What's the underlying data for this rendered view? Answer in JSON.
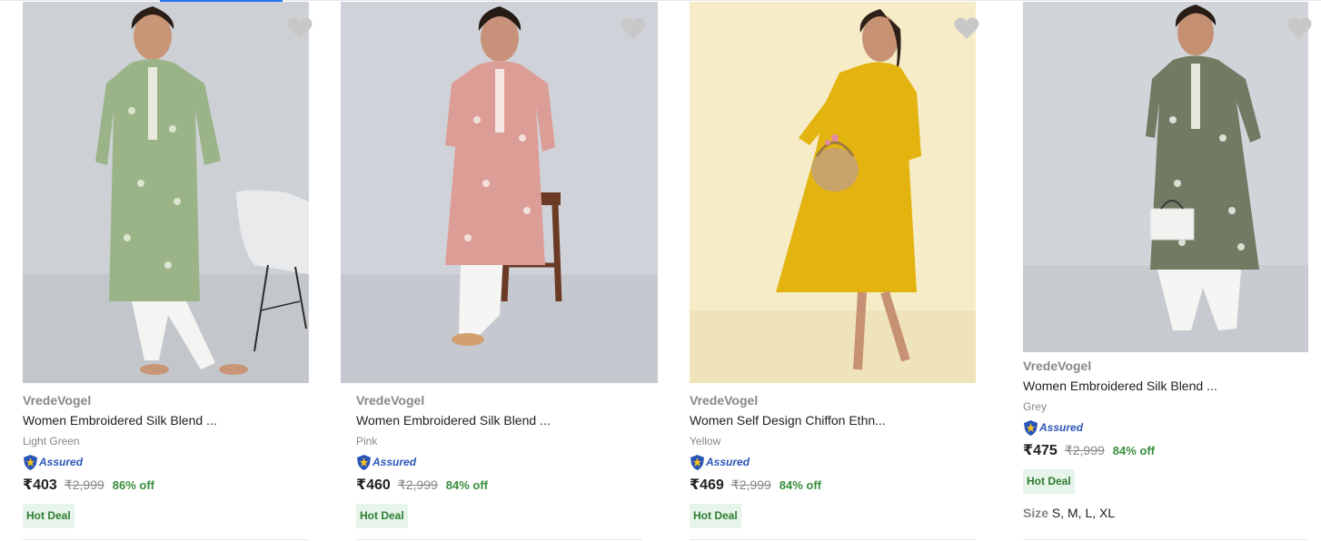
{
  "colors": {
    "brand_text": "#878787",
    "assured_blue": "#2a55b8",
    "discount_green": "#388e3c",
    "hot_deal_bg": "#e6f4ea",
    "wishlist_grey": "#c8c8c8"
  },
  "products": [
    {
      "brand": "VredeVogel",
      "title": "Women Embroidered Silk Blend ...",
      "color": "Light Green",
      "assured": "Assured",
      "price": "₹403",
      "mrp": "₹2,999",
      "discount": "86% off",
      "badge": "Hot Deal",
      "icon": "heart-icon"
    },
    {
      "brand": "VredeVogel",
      "title": "Women Embroidered Silk Blend ...",
      "color": "Pink",
      "assured": "Assured",
      "price": "₹460",
      "mrp": "₹2,999",
      "discount": "84% off",
      "badge": "Hot Deal",
      "icon": "heart-icon"
    },
    {
      "brand": "VredeVogel",
      "title": "Women Self Design Chiffon Ethn...",
      "color": "Yellow",
      "assured": "Assured",
      "price": "₹469",
      "mrp": "₹2,999",
      "discount": "84% off",
      "badge": "Hot Deal",
      "icon": "heart-icon"
    },
    {
      "brand": "VredeVogel",
      "title": "Women Embroidered Silk Blend ...",
      "color": "Grey",
      "assured": "Assured",
      "price": "₹475",
      "mrp": "₹2,999",
      "discount": "84% off",
      "badge": "Hot Deal",
      "size_label": "Size",
      "sizes": "S, M, L, XL",
      "icon": "heart-icon"
    }
  ]
}
